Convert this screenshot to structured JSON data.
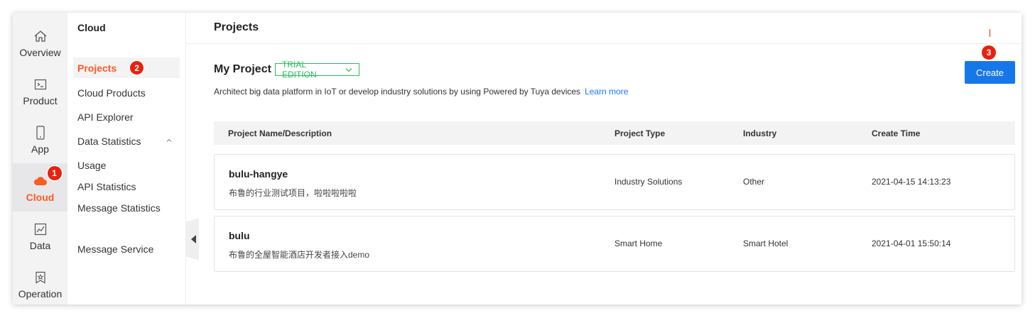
{
  "rail": {
    "items": [
      {
        "label": "Overview",
        "icon": "home-icon"
      },
      {
        "label": "Product",
        "icon": "terminal-icon"
      },
      {
        "label": "App",
        "icon": "phone-icon"
      },
      {
        "label": "Cloud",
        "icon": "cloud-icon",
        "active": true,
        "badge": "1"
      },
      {
        "label": "Data",
        "icon": "chart-icon"
      },
      {
        "label": "Operation",
        "icon": "bookmark-icon"
      }
    ]
  },
  "submenu": {
    "title": "Cloud",
    "items": [
      {
        "label": "Projects",
        "badge": "2",
        "active": true
      },
      {
        "label": "Cloud Products"
      },
      {
        "label": "API Explorer"
      },
      {
        "label": "Data Statistics"
      },
      {
        "label": "Usage"
      },
      {
        "label": "API Statistics"
      },
      {
        "label": "Message Statistics"
      },
      {
        "label": "Message Service"
      }
    ]
  },
  "main": {
    "page_title": "Projects",
    "section_title": "My Project",
    "edition": "TRIAL EDITION",
    "description": "Architect big data platform in IoT or develop industry solutions by using Powered by Tuya devices",
    "learn_more": "Learn more",
    "create_label": "Create",
    "create_badge": "3"
  },
  "table": {
    "headers": [
      "Project Name/Description",
      "Project Type",
      "Industry",
      "Create Time"
    ],
    "rows": [
      {
        "name": "bulu-hangye",
        "description": "布鲁的行业测试项目，啦啦啦啦啦",
        "type": "Industry Solutions",
        "industry": "Other",
        "created": "2021-04-15 14:13:23"
      },
      {
        "name": "bulu",
        "description": "布鲁的全屋智能酒店开发者接入demo",
        "type": "Smart Home",
        "industry": "Smart Hotel",
        "created": "2021-04-01 15:50:14"
      }
    ]
  },
  "colors": {
    "accent": "#ff5a1f",
    "primary": "#1677e8",
    "trial": "#2dbb5f",
    "badge": "#e8210c"
  }
}
